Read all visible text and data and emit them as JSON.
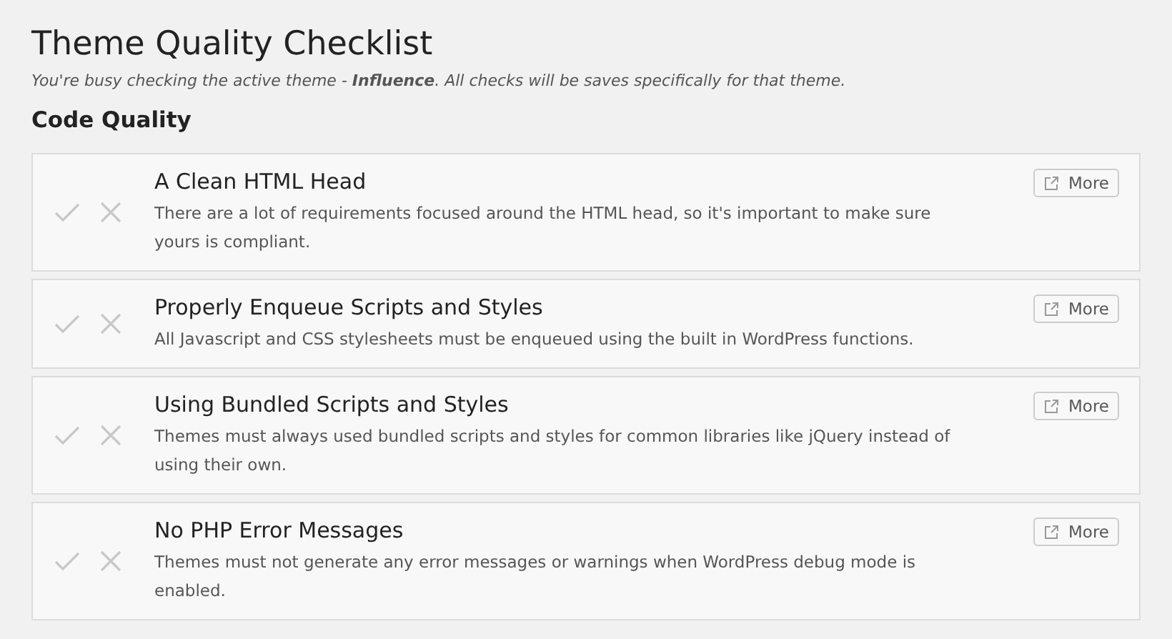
{
  "title": "Theme Quality Checklist",
  "intro": "You're busy checking the active theme - **Influence**. All checks will be saves specifically for that theme.",
  "section": "Code Quality",
  "items": [
    {
      "title": "A Clean HTML Head",
      "description": "There are a lot of requirements focused around the HTML head, so it's important to make sure yours is compliant.",
      "button": "More"
    },
    {
      "title": "Properly Enqueue Scripts and Styles",
      "description": "All Javascript and CSS stylesheets must be enqueued using the built in WordPress functions.",
      "button": "More"
    },
    {
      "title": "Using Bundled Scripts and Styles",
      "description": "Themes must always used bundled scripts and styles for common libraries like jQuery instead of using their own.",
      "button": "More"
    },
    {
      "title": "No PHP Error Messages",
      "description": "Themes must not generate any error messages or warnings when WordPress debug mode is enabled.",
      "button": "More"
    }
  ]
}
